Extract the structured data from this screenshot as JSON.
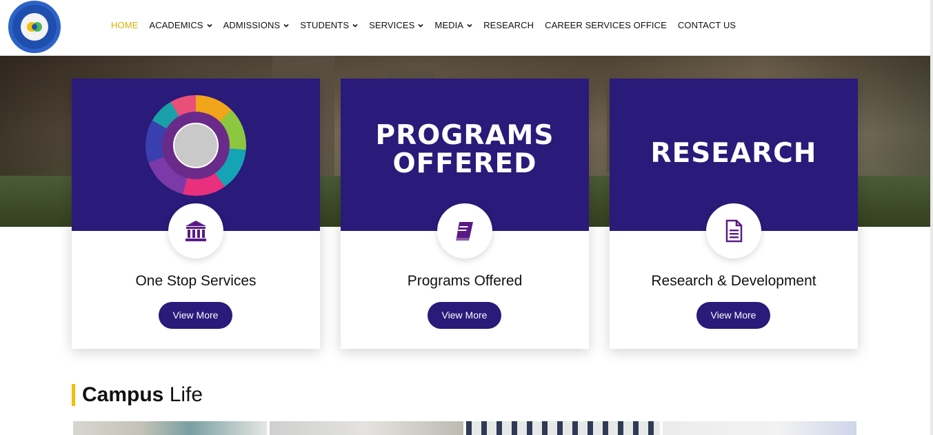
{
  "nav": {
    "items": [
      {
        "label": "HOME",
        "active": true,
        "dropdown": false
      },
      {
        "label": "ACADEMICS",
        "active": false,
        "dropdown": true
      },
      {
        "label": "ADMISSIONS",
        "active": false,
        "dropdown": true
      },
      {
        "label": "STUDENTS",
        "active": false,
        "dropdown": true
      },
      {
        "label": "SERVICES",
        "active": false,
        "dropdown": true
      },
      {
        "label": "MEDIA",
        "active": false,
        "dropdown": true
      },
      {
        "label": "RESEARCH",
        "active": false,
        "dropdown": false
      },
      {
        "label": "CAREER SERVICES OFFICE",
        "active": false,
        "dropdown": false
      },
      {
        "label": "CONTACT US",
        "active": false,
        "dropdown": false
      }
    ]
  },
  "cards": [
    {
      "banner_type": "image",
      "icon": "institution-icon",
      "title": "One Stop Services",
      "button": "View More"
    },
    {
      "banner_lines": [
        "PROGRAMS",
        "OFFERED"
      ],
      "icon": "book-icon",
      "title": "Programs Offered",
      "button": "View More"
    },
    {
      "banner_lines": [
        "RESEARCH"
      ],
      "icon": "document-icon",
      "title": "Research & Development",
      "button": "View More"
    }
  ],
  "campus": {
    "title_bold": "Campus",
    "title_rest": " Life"
  },
  "colors": {
    "primary": "#2a1a7a",
    "accent": "#f2c000",
    "active_nav": "#d4b400"
  }
}
